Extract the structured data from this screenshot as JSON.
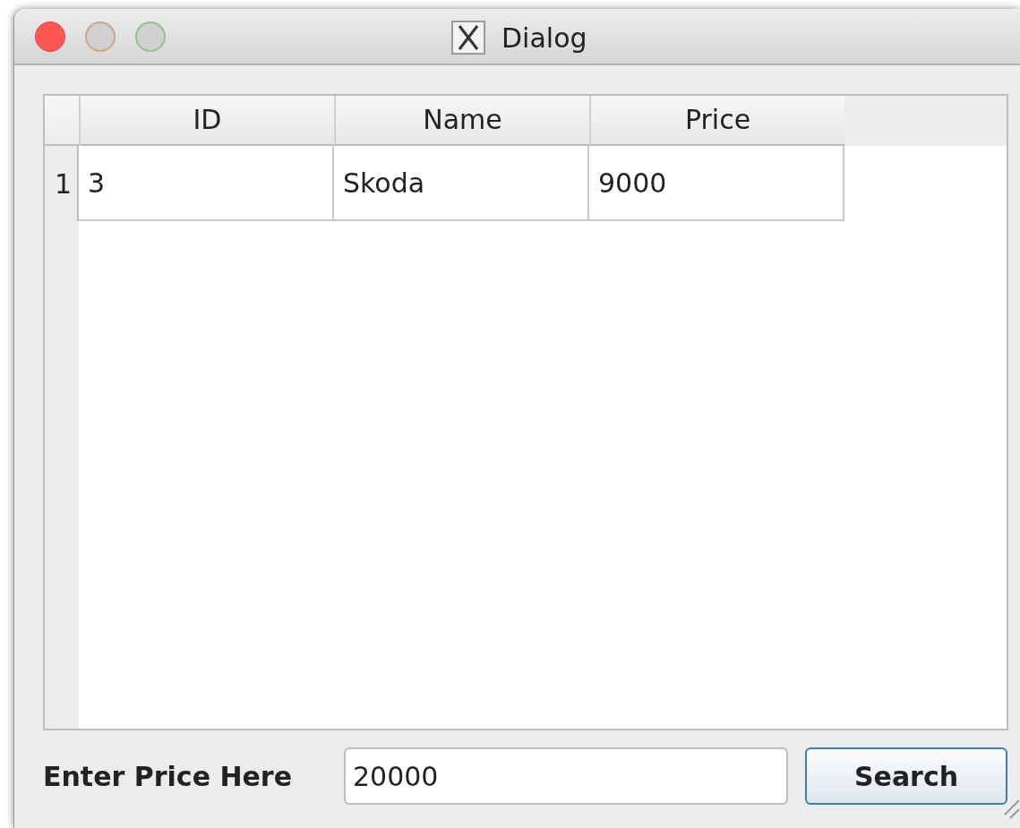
{
  "window": {
    "title": "Dialog"
  },
  "table": {
    "columns": [
      "ID",
      "Name",
      "Price"
    ],
    "rows": [
      {
        "header": "1",
        "cells": [
          "3",
          "Skoda",
          "9000"
        ]
      }
    ]
  },
  "price_field": {
    "label": "Enter Price Here",
    "value": "20000"
  },
  "buttons": [
    {
      "label": "Search",
      "default": true
    }
  ]
}
